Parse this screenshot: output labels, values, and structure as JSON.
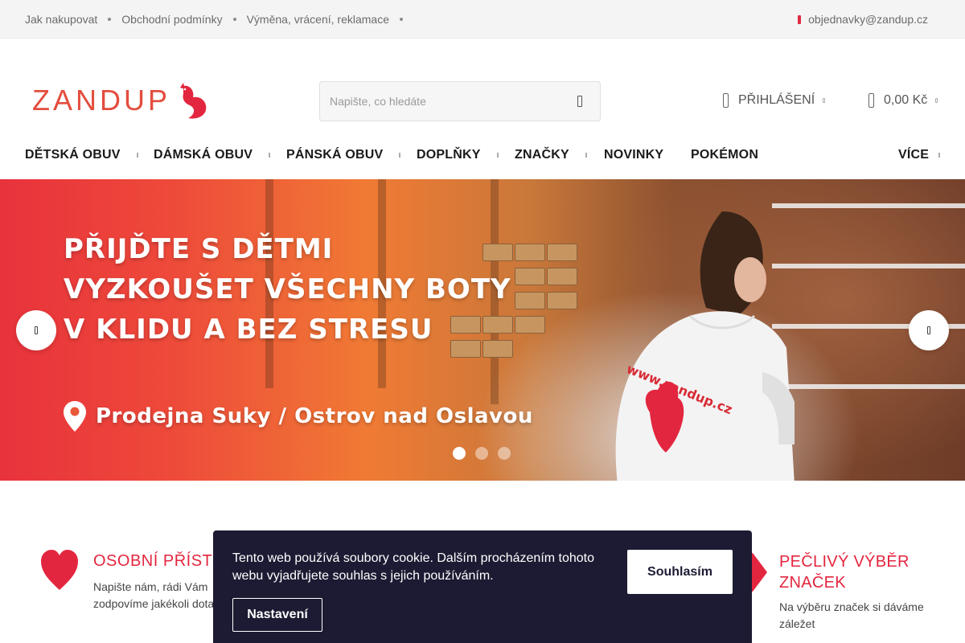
{
  "topbar": {
    "links": [
      "Jak nakupovat",
      "Obchodní podmínky",
      "Výměna, vrácení, reklamace"
    ],
    "email": "objednavky@zandup.cz"
  },
  "header": {
    "logo_text": "ZANDUP",
    "search_placeholder": "Napište, co hledáte",
    "login_label": "PŘIHLÁŠENÍ",
    "cart_total": "0,00 Kč"
  },
  "nav": {
    "items": [
      "DĚTSKÁ OBUV",
      "DÁMSKÁ OBUV",
      "PÁNSKÁ OBUV",
      "DOPLŇKY",
      "ZNAČKY",
      "NOVINKY",
      "POKÉMON",
      "VÍCE"
    ]
  },
  "hero": {
    "title_lines": [
      "PŘIJĎTE S DĚTMI",
      "VYZKOUŠET VŠECHNY BOTY",
      "V KLIDU A BEZ STRESU"
    ],
    "location": "Prodejna Suky / Ostrov nad Oslavou",
    "slides_total": 3,
    "active_slide": 1,
    "hoodie_text": "www.zandup.cz"
  },
  "benefits": [
    {
      "title": "OSOBNÍ PŘÍSTU",
      "desc": "Napište nám, rádi Vám zodpovíme jakékoli dota"
    },
    {
      "title": "PEČLIVÝ VÝBĚR ZNAČEK",
      "desc": "Na výběru značek si dáváme záležet"
    }
  ],
  "cookie": {
    "text": "Tento web používá soubory cookie. Dalším procházením tohoto webu vyjadřujete souhlas s jejich používáním.",
    "accept_label": "Souhlasím",
    "settings_label": "Nastavení"
  },
  "colors": {
    "brand_red": "#e3263f",
    "logo_orange": "#e34d3e",
    "cookie_bg": "#1c1b33"
  }
}
